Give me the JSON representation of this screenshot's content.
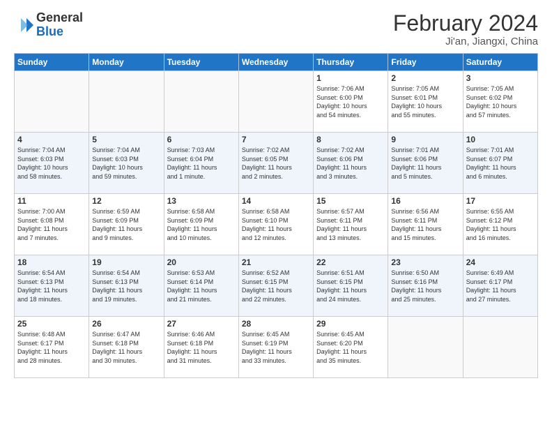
{
  "header": {
    "logo": {
      "general": "General",
      "blue": "Blue"
    },
    "title": "February 2024",
    "location": "Ji'an, Jiangxi, China"
  },
  "days_of_week": [
    "Sunday",
    "Monday",
    "Tuesday",
    "Wednesday",
    "Thursday",
    "Friday",
    "Saturday"
  ],
  "weeks": [
    [
      {
        "day": "",
        "info": ""
      },
      {
        "day": "",
        "info": ""
      },
      {
        "day": "",
        "info": ""
      },
      {
        "day": "",
        "info": ""
      },
      {
        "day": "1",
        "info": "Sunrise: 7:06 AM\nSunset: 6:00 PM\nDaylight: 10 hours\nand 54 minutes."
      },
      {
        "day": "2",
        "info": "Sunrise: 7:05 AM\nSunset: 6:01 PM\nDaylight: 10 hours\nand 55 minutes."
      },
      {
        "day": "3",
        "info": "Sunrise: 7:05 AM\nSunset: 6:02 PM\nDaylight: 10 hours\nand 57 minutes."
      }
    ],
    [
      {
        "day": "4",
        "info": "Sunrise: 7:04 AM\nSunset: 6:03 PM\nDaylight: 10 hours\nand 58 minutes."
      },
      {
        "day": "5",
        "info": "Sunrise: 7:04 AM\nSunset: 6:03 PM\nDaylight: 10 hours\nand 59 minutes."
      },
      {
        "day": "6",
        "info": "Sunrise: 7:03 AM\nSunset: 6:04 PM\nDaylight: 11 hours\nand 1 minute."
      },
      {
        "day": "7",
        "info": "Sunrise: 7:02 AM\nSunset: 6:05 PM\nDaylight: 11 hours\nand 2 minutes."
      },
      {
        "day": "8",
        "info": "Sunrise: 7:02 AM\nSunset: 6:06 PM\nDaylight: 11 hours\nand 3 minutes."
      },
      {
        "day": "9",
        "info": "Sunrise: 7:01 AM\nSunset: 6:06 PM\nDaylight: 11 hours\nand 5 minutes."
      },
      {
        "day": "10",
        "info": "Sunrise: 7:01 AM\nSunset: 6:07 PM\nDaylight: 11 hours\nand 6 minutes."
      }
    ],
    [
      {
        "day": "11",
        "info": "Sunrise: 7:00 AM\nSunset: 6:08 PM\nDaylight: 11 hours\nand 7 minutes."
      },
      {
        "day": "12",
        "info": "Sunrise: 6:59 AM\nSunset: 6:09 PM\nDaylight: 11 hours\nand 9 minutes."
      },
      {
        "day": "13",
        "info": "Sunrise: 6:58 AM\nSunset: 6:09 PM\nDaylight: 11 hours\nand 10 minutes."
      },
      {
        "day": "14",
        "info": "Sunrise: 6:58 AM\nSunset: 6:10 PM\nDaylight: 11 hours\nand 12 minutes."
      },
      {
        "day": "15",
        "info": "Sunrise: 6:57 AM\nSunset: 6:11 PM\nDaylight: 11 hours\nand 13 minutes."
      },
      {
        "day": "16",
        "info": "Sunrise: 6:56 AM\nSunset: 6:11 PM\nDaylight: 11 hours\nand 15 minutes."
      },
      {
        "day": "17",
        "info": "Sunrise: 6:55 AM\nSunset: 6:12 PM\nDaylight: 11 hours\nand 16 minutes."
      }
    ],
    [
      {
        "day": "18",
        "info": "Sunrise: 6:54 AM\nSunset: 6:13 PM\nDaylight: 11 hours\nand 18 minutes."
      },
      {
        "day": "19",
        "info": "Sunrise: 6:54 AM\nSunset: 6:13 PM\nDaylight: 11 hours\nand 19 minutes."
      },
      {
        "day": "20",
        "info": "Sunrise: 6:53 AM\nSunset: 6:14 PM\nDaylight: 11 hours\nand 21 minutes."
      },
      {
        "day": "21",
        "info": "Sunrise: 6:52 AM\nSunset: 6:15 PM\nDaylight: 11 hours\nand 22 minutes."
      },
      {
        "day": "22",
        "info": "Sunrise: 6:51 AM\nSunset: 6:15 PM\nDaylight: 11 hours\nand 24 minutes."
      },
      {
        "day": "23",
        "info": "Sunrise: 6:50 AM\nSunset: 6:16 PM\nDaylight: 11 hours\nand 25 minutes."
      },
      {
        "day": "24",
        "info": "Sunrise: 6:49 AM\nSunset: 6:17 PM\nDaylight: 11 hours\nand 27 minutes."
      }
    ],
    [
      {
        "day": "25",
        "info": "Sunrise: 6:48 AM\nSunset: 6:17 PM\nDaylight: 11 hours\nand 28 minutes."
      },
      {
        "day": "26",
        "info": "Sunrise: 6:47 AM\nSunset: 6:18 PM\nDaylight: 11 hours\nand 30 minutes."
      },
      {
        "day": "27",
        "info": "Sunrise: 6:46 AM\nSunset: 6:18 PM\nDaylight: 11 hours\nand 31 minutes."
      },
      {
        "day": "28",
        "info": "Sunrise: 6:45 AM\nSunset: 6:19 PM\nDaylight: 11 hours\nand 33 minutes."
      },
      {
        "day": "29",
        "info": "Sunrise: 6:45 AM\nSunset: 6:20 PM\nDaylight: 11 hours\nand 35 minutes."
      },
      {
        "day": "",
        "info": ""
      },
      {
        "day": "",
        "info": ""
      }
    ]
  ]
}
